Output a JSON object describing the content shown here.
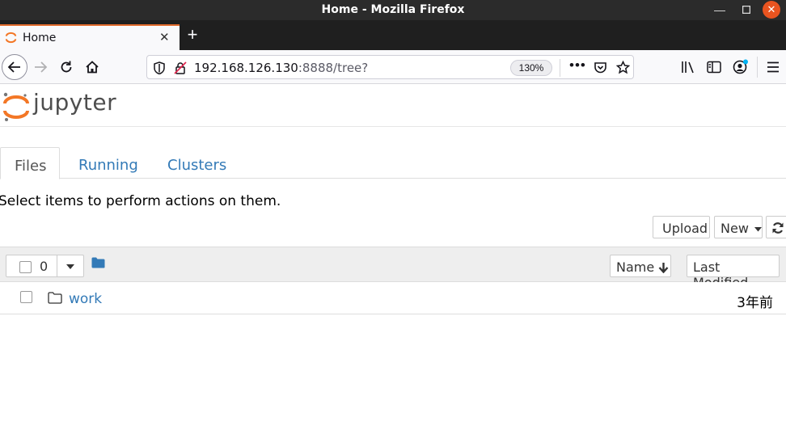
{
  "window": {
    "title": "Home - Mozilla Firefox"
  },
  "browser": {
    "tab": {
      "label": "Home"
    },
    "url": {
      "host": "192.168.126.130",
      "rest": ":8888/tree?"
    },
    "zoom": "130%"
  },
  "jupyter": {
    "logo_text": "jupyter",
    "tabs": [
      "Files",
      "Running",
      "Clusters"
    ],
    "hint": "Select items to perform actions on them.",
    "buttons": {
      "upload": "Upload",
      "new": "New"
    },
    "selection_count": "0",
    "sort": {
      "name": "Name",
      "last_modified": "Last Modified"
    },
    "items": [
      {
        "name": "work",
        "modified": "3年前"
      }
    ]
  },
  "colors": {
    "jupyter_orange": "#f37726",
    "link_blue": "#337ab7",
    "firefox_tab_accent": "#e06a2b",
    "close_button": "#e95420"
  }
}
